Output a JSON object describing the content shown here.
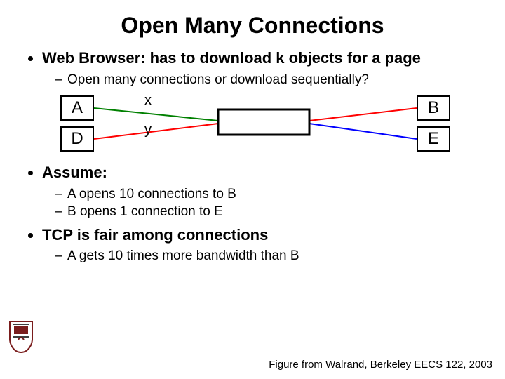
{
  "title": "Open Many Connections",
  "bullets": {
    "b1": {
      "text": "Web Browser: has to download k objects for a page",
      "sub1": "Open many connections or download sequentially?"
    },
    "b2": {
      "text": "Assume:",
      "sub1": "A opens 10 connections to B",
      "sub2": "B opens 1 connection to E"
    },
    "b3": {
      "text": "TCP is fair among connections",
      "sub1": "A gets 10 times more bandwidth than B"
    }
  },
  "diagram": {
    "nodes": {
      "A": "A",
      "D": "D",
      "B": "B",
      "E": "E"
    },
    "labels": {
      "x": "x",
      "y": "y"
    },
    "colors": {
      "green": "#008000",
      "red": "#ff0000",
      "blue": "#0000ff",
      "black": "#000000"
    }
  },
  "credit": "Figure from Walrand, Berkeley EECS 122, 2003"
}
